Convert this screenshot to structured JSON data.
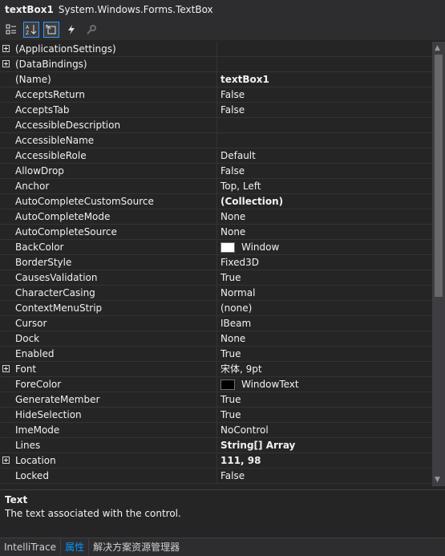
{
  "header": {
    "object_name": "textBox1",
    "object_type": "System.Windows.Forms.TextBox"
  },
  "toolbar": {
    "categorized_icon": "categorized-icon",
    "alphabetical_icon": "alphabetical-icon",
    "properties_icon": "properties-icon",
    "events_icon": "events-icon",
    "property_pages_icon": "property-pages-icon"
  },
  "properties": [
    {
      "name": "(ApplicationSettings)",
      "value": "",
      "expandable": true
    },
    {
      "name": "(DataBindings)",
      "value": "",
      "expandable": true
    },
    {
      "name": "(Name)",
      "value": "textBox1",
      "bold": true
    },
    {
      "name": "AcceptsReturn",
      "value": "False"
    },
    {
      "name": "AcceptsTab",
      "value": "False"
    },
    {
      "name": "AccessibleDescription",
      "value": ""
    },
    {
      "name": "AccessibleName",
      "value": ""
    },
    {
      "name": "AccessibleRole",
      "value": "Default"
    },
    {
      "name": "AllowDrop",
      "value": "False"
    },
    {
      "name": "Anchor",
      "value": "Top, Left"
    },
    {
      "name": "AutoCompleteCustomSource",
      "value": "(Collection)",
      "bold": true
    },
    {
      "name": "AutoCompleteMode",
      "value": "None"
    },
    {
      "name": "AutoCompleteSource",
      "value": "None"
    },
    {
      "name": "BackColor",
      "value": "Window",
      "swatch": "#ffffff"
    },
    {
      "name": "BorderStyle",
      "value": "Fixed3D"
    },
    {
      "name": "CausesValidation",
      "value": "True"
    },
    {
      "name": "CharacterCasing",
      "value": "Normal"
    },
    {
      "name": "ContextMenuStrip",
      "value": "(none)"
    },
    {
      "name": "Cursor",
      "value": "IBeam"
    },
    {
      "name": "Dock",
      "value": "None"
    },
    {
      "name": "Enabled",
      "value": "True"
    },
    {
      "name": "Font",
      "value": "宋体, 9pt",
      "expandable": true
    },
    {
      "name": "ForeColor",
      "value": "WindowText",
      "swatch": "#000000"
    },
    {
      "name": "GenerateMember",
      "value": "True"
    },
    {
      "name": "HideSelection",
      "value": "True"
    },
    {
      "name": "ImeMode",
      "value": "NoControl"
    },
    {
      "name": "Lines",
      "value": "String[] Array",
      "bold": true
    },
    {
      "name": "Location",
      "value": "111, 98",
      "bold": true,
      "expandable": true
    },
    {
      "name": "Locked",
      "value": "False"
    }
  ],
  "description": {
    "title": "Text",
    "text": "The text associated with the control."
  },
  "tabs": [
    {
      "label": "IntelliTrace",
      "active": false
    },
    {
      "label": "属性",
      "active": true
    },
    {
      "label": "解决方案资源管理器",
      "active": false
    }
  ]
}
